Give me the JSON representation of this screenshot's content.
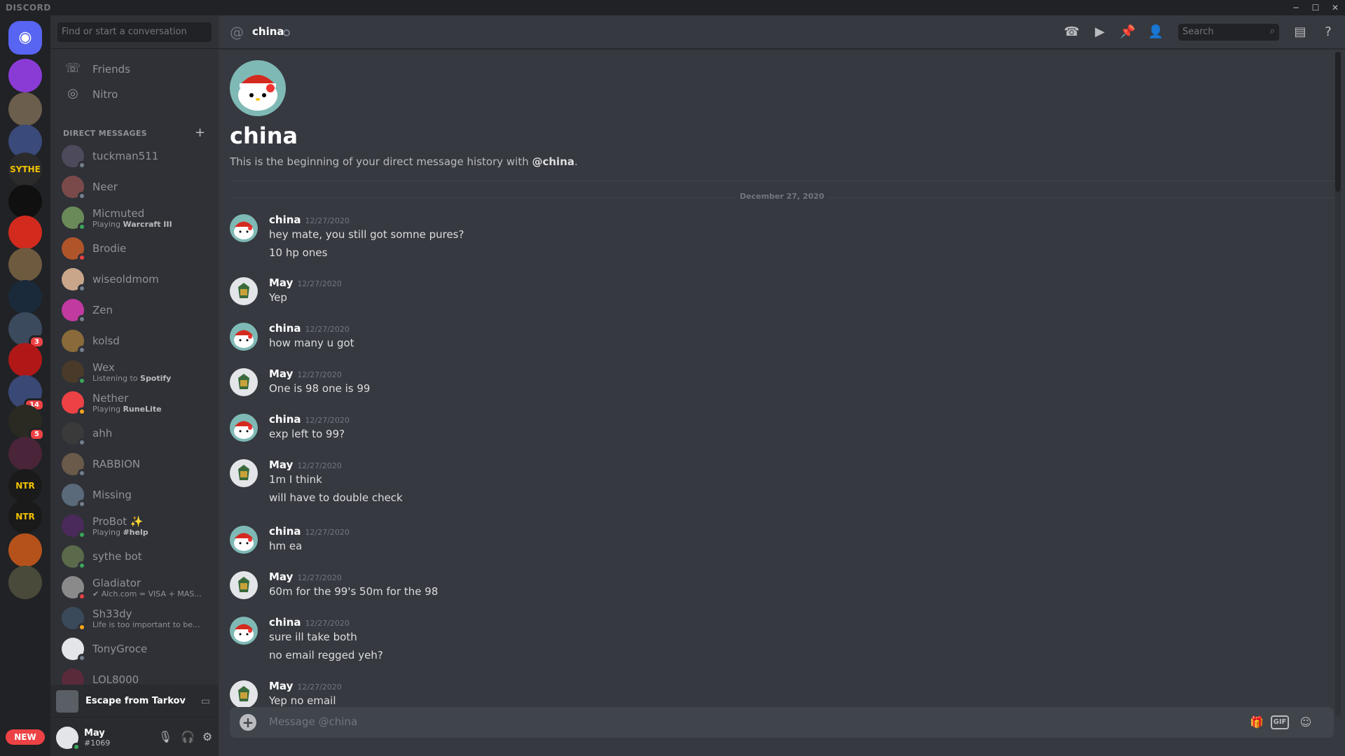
{
  "app": {
    "brand": "DISCORD"
  },
  "window_controls": {
    "minimize": "─",
    "maximize": "☐",
    "close": "✕"
  },
  "servers": {
    "items": [
      {
        "name": "home",
        "color": "#5865f2"
      },
      {
        "name": "server-1",
        "color": "#8a3bd6"
      },
      {
        "name": "server-2",
        "color": "#6b5e4c"
      },
      {
        "name": "folder-1",
        "color": "#3a4a7a"
      },
      {
        "name": "server-sythe",
        "label": "SYTHE",
        "color": "#2b2b2b"
      },
      {
        "name": "server-5",
        "color": "#101010"
      },
      {
        "name": "server-6",
        "color": "#d32a1e"
      },
      {
        "name": "server-7",
        "color": "#6e5a3e"
      },
      {
        "name": "server-8",
        "color": "#1a2a3a"
      },
      {
        "name": "server-9",
        "color": "#3c4a5e",
        "badge": "3"
      },
      {
        "name": "server-10",
        "color": "#b01818"
      },
      {
        "name": "server-11",
        "color": "#3a4876",
        "badge": "14"
      },
      {
        "name": "server-12",
        "color": "#2a2a22",
        "badge": "5"
      },
      {
        "name": "folder-2",
        "color": "#4a2438"
      },
      {
        "name": "server-ntr-1",
        "label": "NTR",
        "color": "#1a1a1a"
      },
      {
        "name": "server-ntr-2",
        "label": "NTR",
        "color": "#1a1a1a"
      },
      {
        "name": "server-15",
        "color": "#b5521b"
      },
      {
        "name": "server-16",
        "color": "#4a4a3a"
      }
    ],
    "new_label": "NEW"
  },
  "dm_panel": {
    "search_placeholder": "Find or start a conversation",
    "nav": [
      {
        "label": "Friends",
        "icon": "friends-icon"
      },
      {
        "label": "Nitro",
        "icon": "nitro-icon"
      }
    ],
    "header": "DIRECT MESSAGES",
    "dms": [
      {
        "name": "tuckman511",
        "status_color": "#747f8d",
        "avatar": "#4d4a5c"
      },
      {
        "name": "Neer",
        "status_color": "#747f8d",
        "avatar": "#7a4a4a"
      },
      {
        "name": "Micmuted",
        "sub_prefix": "Playing ",
        "sub_bold": "Warcraft III",
        "status_color": "#3ba55c",
        "avatar": "#6a8a5a"
      },
      {
        "name": "Brodie",
        "status_color": "#ed4245",
        "avatar": "#b0542a"
      },
      {
        "name": "wiseoldmom",
        "status_color": "#747f8d",
        "avatar": "#c9a68a"
      },
      {
        "name": "Zen",
        "status_color": "#747f8d",
        "avatar": "#c03aa0"
      },
      {
        "name": "kolsd",
        "status_color": "#747f8d",
        "avatar": "#8a6a3a"
      },
      {
        "name": "Wex",
        "sub_prefix": "Listening to ",
        "sub_bold": "Spotify",
        "status_color": "#3ba55c",
        "avatar": "#4a3a2a"
      },
      {
        "name": "Nether",
        "sub_prefix": "Playing ",
        "sub_bold": "RuneLite",
        "status_color": "#faa61a",
        "avatar": "#ed4245"
      },
      {
        "name": "ahh",
        "status_color": "#747f8d",
        "avatar": "#3a3a3a"
      },
      {
        "name": "RABBION",
        "status_color": "#747f8d",
        "avatar": "#6a5a4a"
      },
      {
        "name": "Missing",
        "status_color": "#747f8d",
        "avatar": "#5a6a7a"
      },
      {
        "name": "ProBot ✨",
        "sub_prefix": "Playing ",
        "sub_bold": "#help",
        "status_color": "#3ba55c",
        "avatar": "#4a2a5a"
      },
      {
        "name": "sythe bot",
        "status_color": "#3ba55c",
        "avatar": "#5a6a4a"
      },
      {
        "name": "Gladiator",
        "sub_prefix": "",
        "sub_bold": "",
        "sub_text": "✔ Alch.com = VISA + MAS...",
        "status_color": "#ed4245",
        "avatar": "#8a8a8a"
      },
      {
        "name": "Sh33dy",
        "sub_text": "Life is too important to be...",
        "status_color": "#faa61a",
        "avatar": "#3a4a5a"
      },
      {
        "name": "TonyGroce",
        "status_color": "#747f8d",
        "avatar": "#e3e5e8"
      },
      {
        "name": "LOL8000",
        "status_color": "#747f8d",
        "avatar": "#5a2a3a"
      }
    ]
  },
  "activity": {
    "game": "Escape from Tarkov"
  },
  "user": {
    "name": "May",
    "discriminator": "#1069"
  },
  "chat": {
    "channel_name": "china",
    "search_placeholder": "Search",
    "intro_name": "china",
    "intro_text_prefix": "This is the beginning of your direct message history with ",
    "intro_mention": "@china",
    "intro_suffix": ".",
    "date_divider": "December 27, 2020",
    "composer_placeholder": "Message @china",
    "messages": [
      {
        "author": "china",
        "time": "12/27/2020",
        "lines": [
          "hey mate, you still got somne pures?",
          "10 hp ones"
        ]
      },
      {
        "author": "May",
        "time": "12/27/2020",
        "lines": [
          "Yep"
        ]
      },
      {
        "author": "china",
        "time": "12/27/2020",
        "lines": [
          "how many u got"
        ]
      },
      {
        "author": "May",
        "time": "12/27/2020",
        "lines": [
          "One is 98 one is 99"
        ]
      },
      {
        "author": "china",
        "time": "12/27/2020",
        "lines": [
          "exp left to 99?"
        ]
      },
      {
        "author": "May",
        "time": "12/27/2020",
        "lines": [
          "1m I think",
          "will have to double check"
        ]
      },
      {
        "author": "china",
        "time": "12/27/2020",
        "lines": [
          "hm ea"
        ]
      },
      {
        "author": "May",
        "time": "12/27/2020",
        "lines": [
          "60m for the 99's 50m for the 98"
        ]
      },
      {
        "author": "china",
        "time": "12/27/2020",
        "lines": [
          "sure ill take both",
          "no email regged yeh?"
        ]
      },
      {
        "author": "May",
        "time": "12/27/2020",
        "lines": [
          "Yep no email"
        ]
      }
    ]
  }
}
